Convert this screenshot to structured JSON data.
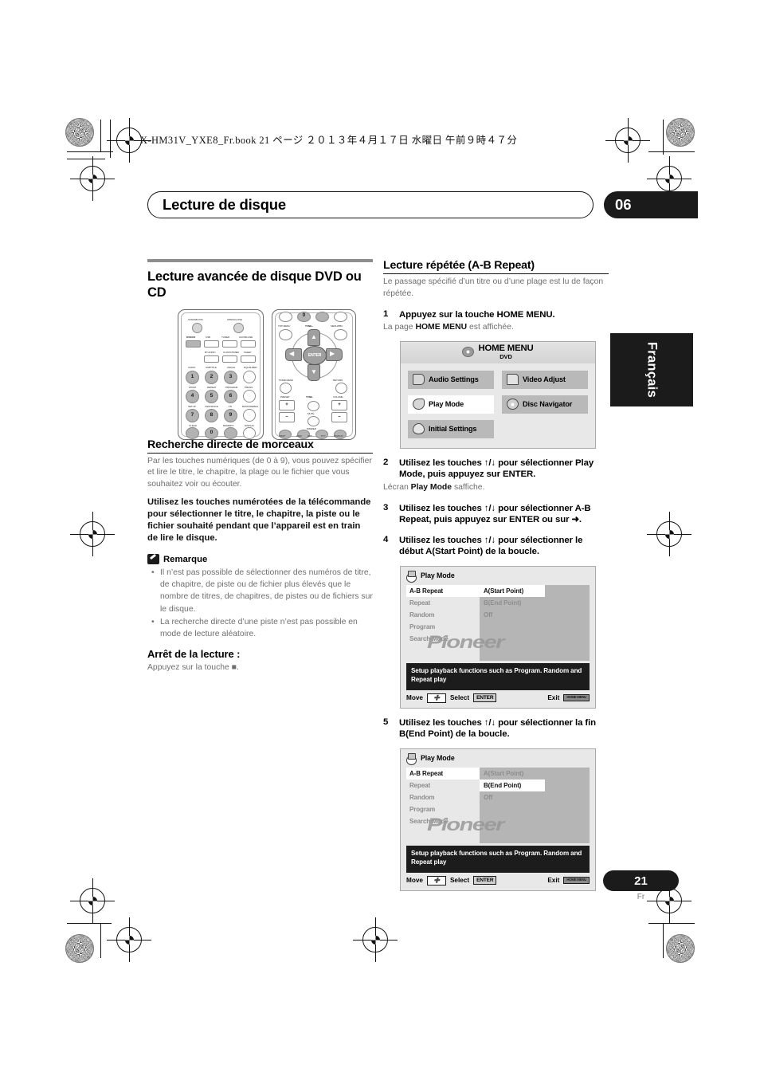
{
  "print": {
    "book_line": "X-HM31V_YXE8_Fr.book   21 ページ   ２０１３年４月１７日   水曜日   午前９時４７分"
  },
  "header": {
    "chapter_title": "Lecture de disque",
    "chapter_number": "06",
    "language_tab": "Français"
  },
  "left_column": {
    "section_title": "Lecture avancée de disque DVD ou CD",
    "remote": {
      "labels": [
        "STANDBY/ON",
        "OPEN/CLOSE",
        "DVD/CD",
        "USB",
        "TUNER",
        "AUX/MI.LINE",
        "BT AUDIO",
        "CLOCK/TIMER",
        "SLEEP",
        "AUDIO",
        "SUBTITLE",
        "ANGLE",
        "EQUALIZER",
        "ZOOM",
        "REPEAT",
        "PROGRAM",
        "P.BASS",
        "SETUP",
        "V.ENHANCE",
        "FN",
        "BASS/TREBLE",
        "CLEAR",
        "RDM/RPT",
        "DISPLAY",
        "TOP MENU",
        "TUNE+",
        "MENU/PBC",
        "HOME MENU",
        "RETURN",
        "PRESET",
        "TUNE-",
        "VOLUME",
        "MUTE",
        "DIMMER",
        "SHIFT",
        "RDM",
        "RPT",
        "PTY",
        "DISPLAY"
      ],
      "numbers": [
        "1",
        "2",
        "3",
        "4",
        "5",
        "6",
        "7",
        "8",
        "9",
        "0"
      ],
      "enter_label": "ENTER"
    },
    "direct_search": {
      "heading": "Recherche directe de morceaux",
      "body": "Par les touches numériques (de 0 à 9), vous pouvez spécifier et lire le titre, le chapitre, la plage ou le fichier que vous souhaitez voir ou écouter.",
      "bold": "Utilisez les touches numérotées de la télécommande pour sélectionner le titre, le chapitre, la piste ou le fichier souhaité pendant que l’appareil est en train de lire le disque."
    },
    "note": {
      "heading": "Remarque",
      "items": [
        "Il n’est pas possible de sélectionner des numéros de titre, de chapitre, de piste ou de fichier plus élevés que le nombre de titres, de chapitres, de pistes ou de fichiers sur le disque.",
        "La recherche directe d’une piste n’est pas possible en mode de lecture aléatoire."
      ]
    },
    "stop_play": {
      "heading": "Arrêt de la lecture :",
      "body": "Appuyez sur la touche ■."
    }
  },
  "right_column": {
    "section_heading": "Lecture répétée (A-B Repeat)",
    "section_intro": "Le passage spécifié d’un titre ou d’une plage est lu de façon répétée.",
    "steps": [
      {
        "num": "1",
        "text": "Appuyez sur la touche HOME MENU.",
        "sub_prefix": "La page ",
        "sub_bold": "HOME MENU",
        "sub_suffix": " est affichée."
      },
      {
        "num": "2",
        "text": "Utilisez les touches ↑/↓ pour sélectionner Play Mode, puis appuyez sur ENTER.",
        "sub_prefix": "Lécran ",
        "sub_bold": "Play Mode",
        "sub_suffix": " saffiche."
      },
      {
        "num": "3",
        "text": "Utilisez les touches ↑/↓ pour sélectionner A-B Repeat, puis appuyez sur ENTER ou sur ➜."
      },
      {
        "num": "4",
        "text": "Utilisez les touches ↑/↓ pour sélectionner le début A(Start Point) de la boucle."
      },
      {
        "num": "5",
        "text": "Utilisez les touches ↑/↓ pour sélectionner la fin B(End Point) de la boucle."
      }
    ],
    "home_menu_osd": {
      "title": "HOME MENU",
      "subtitle": "DVD",
      "cells": [
        {
          "label": "Audio Settings",
          "icon": "audio-settings-icon",
          "selected": false
        },
        {
          "label": "Video Adjust",
          "icon": "video-adjust-icon",
          "selected": false
        },
        {
          "label": "Play Mode",
          "icon": "play-mode-icon",
          "selected": true
        },
        {
          "label": "Disc Navigator",
          "icon": "disc-navigator-icon",
          "selected": false
        },
        {
          "label": "Initial Settings",
          "icon": "initial-settings-icon",
          "selected": false
        }
      ]
    },
    "play_mode_osd_1": {
      "title": "Play Mode",
      "menu_items": [
        "A-B Repeat",
        "Repeat",
        "Random",
        "Program",
        "Search Mode"
      ],
      "active_menu_index": 0,
      "options": [
        "A(Start Point)",
        "B(End Point)",
        "Off"
      ],
      "active_option_index": 0,
      "watermark": "Pioneer",
      "description": "Setup playback functions such as Program. Random and Repeat play",
      "footer": {
        "move_label": "Move",
        "move_key": "pad",
        "select_label": "Select",
        "select_key": "ENTER",
        "exit_label": "Exit",
        "exit_key": "HOME MENU"
      }
    },
    "play_mode_osd_2": {
      "title": "Play Mode",
      "menu_items": [
        "A-B Repeat",
        "Repeat",
        "Random",
        "Program",
        "Search Mode"
      ],
      "active_menu_index": 0,
      "options": [
        "A(Start Point)",
        "B(End Point)",
        "Off"
      ],
      "active_option_index": 1,
      "watermark": "Pioneer",
      "description": "Setup playback functions such as Program. Random and Repeat play",
      "footer": {
        "move_label": "Move",
        "move_key": "pad",
        "select_label": "Select",
        "select_key": "ENTER",
        "exit_label": "Exit",
        "exit_key": "HOME MENU"
      }
    }
  },
  "footer": {
    "page_number": "21",
    "page_lang": "Fr"
  }
}
